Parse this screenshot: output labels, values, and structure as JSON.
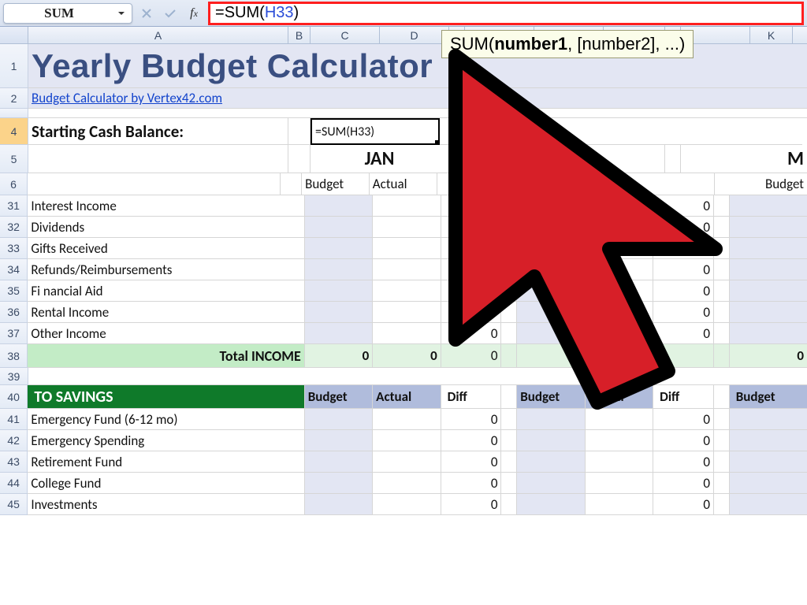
{
  "formula_bar": {
    "name_box": "SUM",
    "formula_raw": "=SUM(H33)",
    "formula_tokens": {
      "eq": "=",
      "fn": "SUM",
      "open": "(",
      "ref": "H33",
      "close": ")"
    },
    "tooltip": {
      "fn": "SUM",
      "sig1": "number1",
      "sig2": ", [number2], ...)"
    }
  },
  "columns": {
    "A": 330,
    "B": 28,
    "C": 88,
    "D": 88,
    "gap1": 20,
    "E": 88,
    "F": 88,
    "G": 78,
    "gap2": 20,
    "H": 88,
    "I": 88,
    "J": 78,
    "K": 20
  },
  "col_labels": [
    "A",
    "B",
    "C",
    "D",
    "",
    "",
    "",
    "",
    "",
    "",
    "K"
  ],
  "title": "Yearly Budget Calculator",
  "subtitle": "Budget Calculator by Vertex42.com",
  "starting_label": "Starting Cash Balance:",
  "editing_value": "=SUM(H33)",
  "months": {
    "m1": "JAN",
    "m2": "",
    "m3": "M"
  },
  "colhdrs": {
    "b": "Budget",
    "a": "Actual",
    "d": "Diff"
  },
  "income_rows": [
    {
      "n": 31,
      "label": "Interest Income",
      "diff": "0"
    },
    {
      "n": 32,
      "label": "Dividends",
      "diff": "0"
    },
    {
      "n": 33,
      "label": "Gifts Received",
      "diff": "0"
    },
    {
      "n": 34,
      "label": "Refunds/Reimbursements",
      "diff": "0"
    },
    {
      "n": 35,
      "label": "Fi nancial Aid",
      "diff": "0"
    },
    {
      "n": 36,
      "label": "Rental Income",
      "diff": "0"
    },
    {
      "n": 37,
      "label": "Other Income",
      "diff": "0"
    }
  ],
  "total_row": {
    "n": 38,
    "label": "Total INCOME",
    "v": "0"
  },
  "savings_hdr": {
    "n": 40,
    "label": "TO SAVINGS"
  },
  "saving_rows": [
    {
      "n": 41,
      "label": "Emergency Fund (6-12 mo)",
      "diff": "0"
    },
    {
      "n": 42,
      "label": "Emergency Spending",
      "diff": "0"
    },
    {
      "n": 43,
      "label": "Retirement Fund",
      "diff": "0"
    },
    {
      "n": 44,
      "label": "College Fund",
      "diff": "0"
    },
    {
      "n": 45,
      "label": "Investments",
      "diff": "0"
    }
  ]
}
